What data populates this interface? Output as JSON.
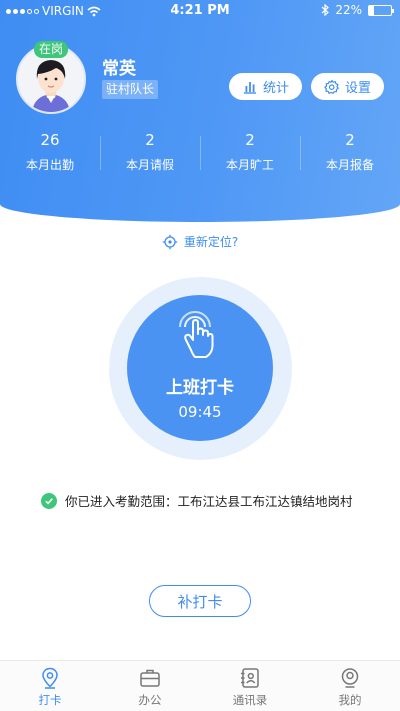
{
  "status_bar": {
    "carrier": "VIRGIN",
    "time": "4:21 PM",
    "battery": "22%",
    "battery_level": 0.22
  },
  "user": {
    "name": "常英",
    "role": "驻村队长",
    "status_badge": "在岗"
  },
  "actions": {
    "stats_label": "统计",
    "settings_label": "设置"
  },
  "stats": [
    {
      "value": "26",
      "label": "本月出勤"
    },
    {
      "value": "2",
      "label": "本月请假"
    },
    {
      "value": "2",
      "label": "本月旷工"
    },
    {
      "value": "2",
      "label": "本月报备"
    }
  ],
  "relocate": {
    "label": "重新定位?"
  },
  "punch": {
    "label": "上班打卡",
    "time": "09:45"
  },
  "range": {
    "message": "你已进入考勤范围：工布江达县工布江达镇结地岗村"
  },
  "supplement": {
    "label": "补打卡"
  },
  "tabbar": {
    "items": [
      {
        "label": "打卡",
        "icon": "location-pin-icon",
        "active": true
      },
      {
        "label": "办公",
        "icon": "briefcase-icon",
        "active": false
      },
      {
        "label": "通讯录",
        "icon": "contacts-icon",
        "active": false
      },
      {
        "label": "我的",
        "icon": "profile-icon",
        "active": false
      }
    ]
  },
  "colors": {
    "primary": "#3f8df3",
    "success": "#3ec67a",
    "light_ring": "#e6f0fd"
  }
}
